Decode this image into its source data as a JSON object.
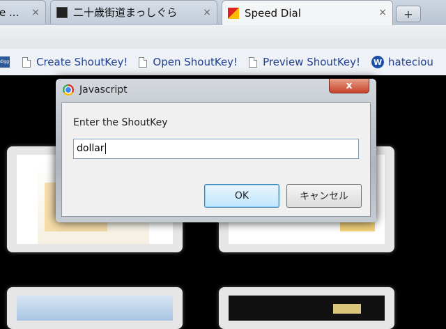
{
  "tabs": [
    {
      "title": "e ...",
      "active": false
    },
    {
      "title": "二十歳街道まっしぐら",
      "active": false
    },
    {
      "title": "Speed Dial",
      "active": true
    }
  ],
  "new_tab_label": "+",
  "tab_close_glyph": "×",
  "bookmarks": [
    {
      "label": "Create ShoutKey!"
    },
    {
      "label": "Open ShoutKey!"
    },
    {
      "label": "Preview ShoutKey!"
    },
    {
      "label": "hateciou"
    }
  ],
  "bookmark_fragment": "digg",
  "dialog": {
    "title": "Javascript",
    "close_glyph": "x",
    "prompt": "Enter the ShoutKey",
    "input_value": "dollar",
    "ok_label": "OK",
    "cancel_label": "キャンセル"
  }
}
